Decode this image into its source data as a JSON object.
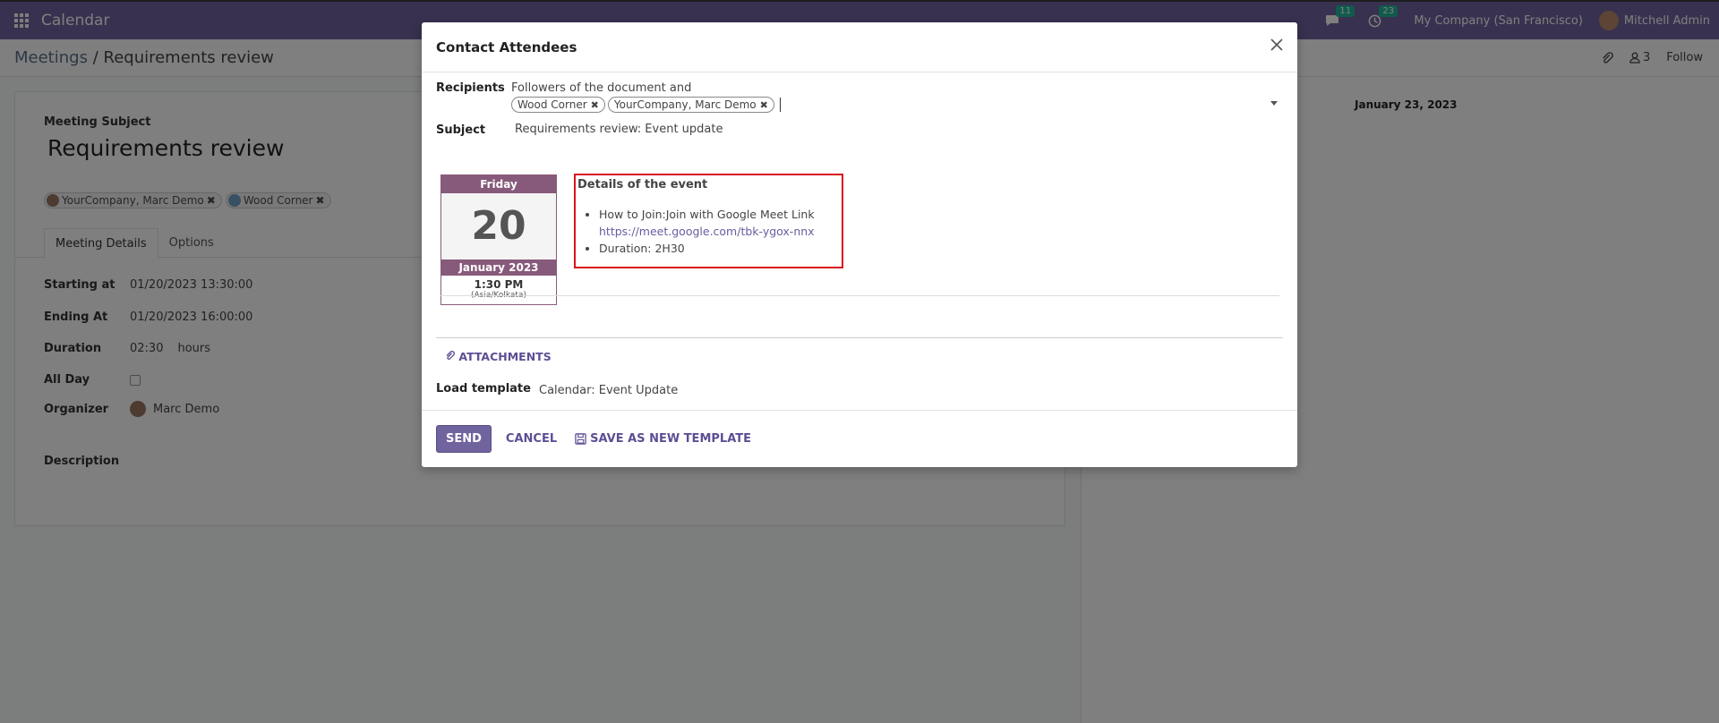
{
  "navbar": {
    "app_title": "Calendar",
    "messages_count": "11",
    "activities_count": "23",
    "company": "My Company (San Francisco)",
    "user": "Mitchell Admin"
  },
  "control_panel": {
    "breadcrumb_parent": "Meetings",
    "breadcrumb_sep": "/",
    "breadcrumb_current": "Requirements review",
    "followers_count": "3",
    "follow_label": "Follow"
  },
  "form": {
    "subject_label": "Meeting Subject",
    "title": "Requirements review",
    "attendee_tags": [
      "YourCompany, Marc Demo",
      "Wood Corner"
    ],
    "tabs": [
      "Meeting Details",
      "Options"
    ],
    "fields": {
      "starting_label": "Starting at",
      "starting_val": "01/20/2023 13:30:00",
      "ending_label": "Ending At",
      "ending_val": "01/20/2023 16:00:00",
      "duration_label": "Duration",
      "duration_val": "02:30",
      "duration_unit": "hours",
      "allday_label": "All Day",
      "organizer_label": "Organizer",
      "organizer_val": "Marc Demo",
      "description_label": "Description"
    }
  },
  "chatter": {
    "date": "January 23, 2023"
  },
  "modal": {
    "title": "Contact Attendees",
    "recipients_label": "Recipients",
    "recipients_text": "Followers of the document and",
    "recipient_tags": [
      "Wood Corner",
      "YourCompany, Marc Demo"
    ],
    "subject_label": "Subject",
    "subject_val": "Requirements review: Event update",
    "calendar": {
      "day": "Friday",
      "date": "20",
      "month": "January 2023",
      "time": "1:30 PM",
      "tz": "(Asia/Kolkata)"
    },
    "details": {
      "title": "Details of the event",
      "join_label": "How to Join:Join with Google Meet Link",
      "join_url": "https://meet.google.com/tbk-ygox-nnx",
      "duration": "Duration: 2H30"
    },
    "attachments_label": "ATTACHMENTS",
    "template_label": "Load template",
    "template_val": "Calendar: Event Update",
    "send_label": "SEND",
    "cancel_label": "CANCEL",
    "save_template_label": "SAVE AS NEW TEMPLATE"
  }
}
